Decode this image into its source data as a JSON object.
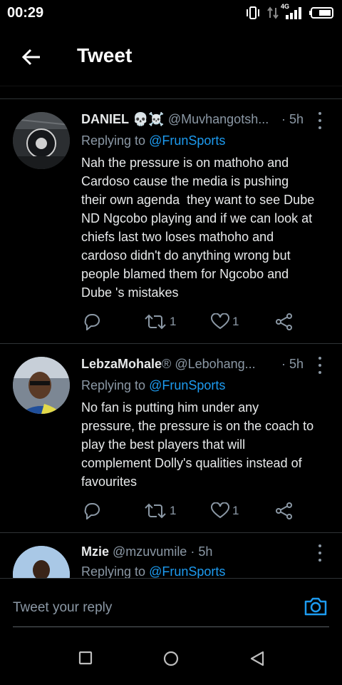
{
  "status": {
    "time": "00:29",
    "network": "4G"
  },
  "header": {
    "title": "Tweet"
  },
  "tweets": [
    {
      "name": "DANIEL",
      "emojis": "💀☠️",
      "handle": "@Muvhangotsh...",
      "separator": "·",
      "time": "5h",
      "replying_prefix": "Replying to",
      "replying_to": "@FrunSports",
      "lines": [
        "Nah the pressure is on mathoho and",
        "Cardoso cause the media is pushing",
        "their own agenda  they want to see Dube",
        "ND Ngcobo playing and if we can look at",
        "chiefs last two loses mathoho and",
        "cardoso didn't do anything wrong but",
        "people blamed them for Ngcobo and",
        "Dube 's mistakes"
      ],
      "retweets": "1",
      "likes": "1"
    },
    {
      "name": "LebzaMohale",
      "emojis": "®",
      "handle": "@Lebohang...",
      "separator": "·",
      "time": "5h",
      "replying_prefix": "Replying to",
      "replying_to": "@FrunSports",
      "lines": [
        "No fan is putting him under any",
        "pressure, the pressure is on the coach to",
        "play the best players that will",
        "complement Dolly's qualities instead of",
        "favourites"
      ],
      "retweets": "1",
      "likes": "1"
    },
    {
      "name": "Mzie",
      "handle": "@mzuvumile",
      "separator": "·",
      "time": "5h",
      "replying_prefix": "Replying to",
      "replying_to": "@FrunSports"
    }
  ],
  "reply": {
    "placeholder": "Tweet your reply"
  },
  "icons": {
    "back": "arrow-left-icon",
    "more": "more-vertical-icon",
    "reply": "reply-icon",
    "retweet": "retweet-icon",
    "like": "heart-icon",
    "share": "share-icon",
    "camera": "camera-icon",
    "nav_recents": "square-icon",
    "nav_home": "circle-icon",
    "nav_back": "triangle-back-icon"
  },
  "colors": {
    "background": "#000000",
    "accent": "#1d9bf0",
    "secondary_text": "#8b98a5"
  }
}
